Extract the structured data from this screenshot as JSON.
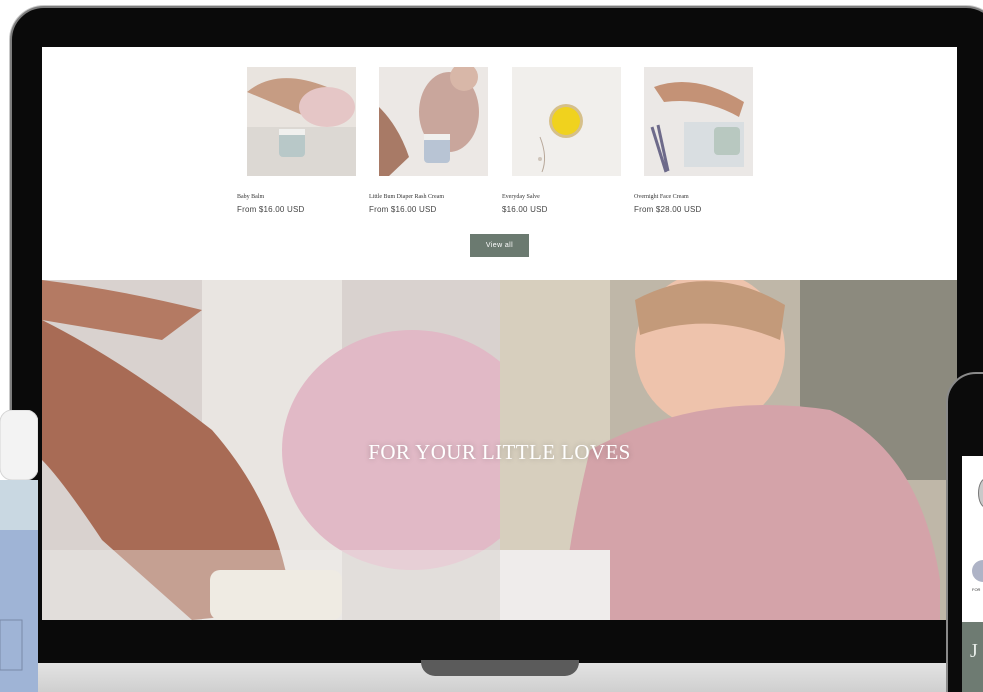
{
  "products": [
    {
      "name": "Baby Balm",
      "price": "From $16.00 USD"
    },
    {
      "name": "Little Bum Diaper Rash Cream",
      "price": "From $16.00 USD"
    },
    {
      "name": "Everyday Salve",
      "price": "$16.00 USD"
    },
    {
      "name": "Overnight Face Cream",
      "price": "From $28.00 USD"
    }
  ],
  "view_all_label": "View all",
  "hero": {
    "title": "FOR YOUR LITTLE LOVES"
  },
  "phone": {
    "tiny_text": "FOR",
    "letter": "J"
  },
  "colors": {
    "button": "#6b7a70",
    "laptop": "#0a0a0a"
  }
}
